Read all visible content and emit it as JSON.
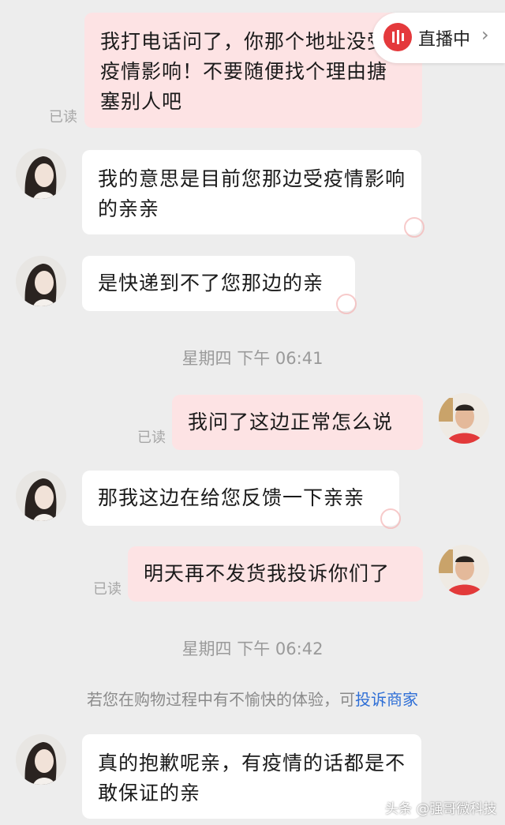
{
  "live_badge": {
    "label": "直播中",
    "icon": "live-broadcast-icon",
    "chevron": "›"
  },
  "messages": [
    {
      "from": "me",
      "text": "我打电话问了，你那个地址没受疫情影响！不要随便找个理由搪塞别人吧",
      "status": "已读"
    },
    {
      "from": "them",
      "text": "我的意思是目前您那边受疫情影响的亲亲"
    },
    {
      "from": "them",
      "text": "是快递到不了您那边的亲"
    },
    {
      "from": "time",
      "text": "星期四 下午 06:41"
    },
    {
      "from": "me",
      "text": "我问了这边正常怎么说",
      "status": "已读"
    },
    {
      "from": "them",
      "text": "那我这边在给您反馈一下亲亲"
    },
    {
      "from": "me",
      "text": "明天再不发货我投诉你们了",
      "status": "已读"
    },
    {
      "from": "time",
      "text": "星期四 下午 06:42"
    },
    {
      "from": "notice",
      "text": "若您在购物过程中有不愉快的体验，可",
      "link": "投诉商家"
    },
    {
      "from": "them",
      "text": "真的抱歉呢亲，有疫情的话都是不敢保证的亲"
    }
  ],
  "watermark": "头条 @强哥微科技",
  "colors": {
    "mine_bubble": "#fde3e4",
    "their_bubble": "#ffffff",
    "link": "#2f6fd6",
    "live": "#e4393c"
  }
}
